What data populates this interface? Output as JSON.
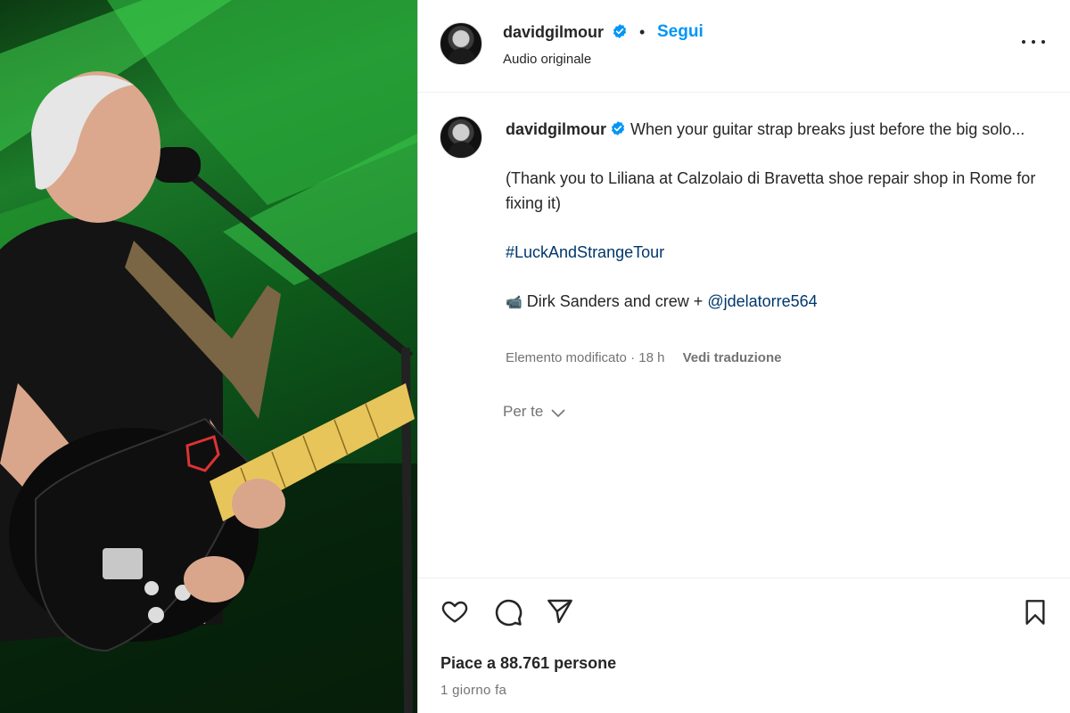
{
  "post": {
    "username": "davidgilmour",
    "follow_label": "Segui",
    "separator": "•",
    "audio_label": "Audio originale",
    "caption": {
      "text": "When your guitar strap breaks just before the big solo...",
      "thanks": "(Thank you to Liliana at Calzolaio di Bravetta shoe repair shop in Rome for fixing it)",
      "hashtag": "#LuckAndStrangeTour",
      "credit_emoji": "📹",
      "credit_text": "Dirk Sanders and crew +",
      "credit_mention": "@jdelatorre564"
    },
    "edited_label": "Elemento modificato",
    "edited_sep": "·",
    "edited_time": "18 h",
    "translate_label": "Vedi traduzione",
    "for_you_label": "Per te",
    "likes_text": "Piace a 88.761 persone",
    "time_ago": "1 giorno fa"
  },
  "icons": {
    "verified": "verified-badge-icon",
    "more": "more-options-icon",
    "like": "heart-icon",
    "comment": "comment-icon",
    "share": "paper-plane-icon",
    "save": "bookmark-icon",
    "for_you": "chevron-down-icon"
  },
  "colors": {
    "accent": "#0095f6",
    "link": "#00376b",
    "muted": "#737373",
    "text": "#262626",
    "stage_green": "#1c7d2a"
  }
}
